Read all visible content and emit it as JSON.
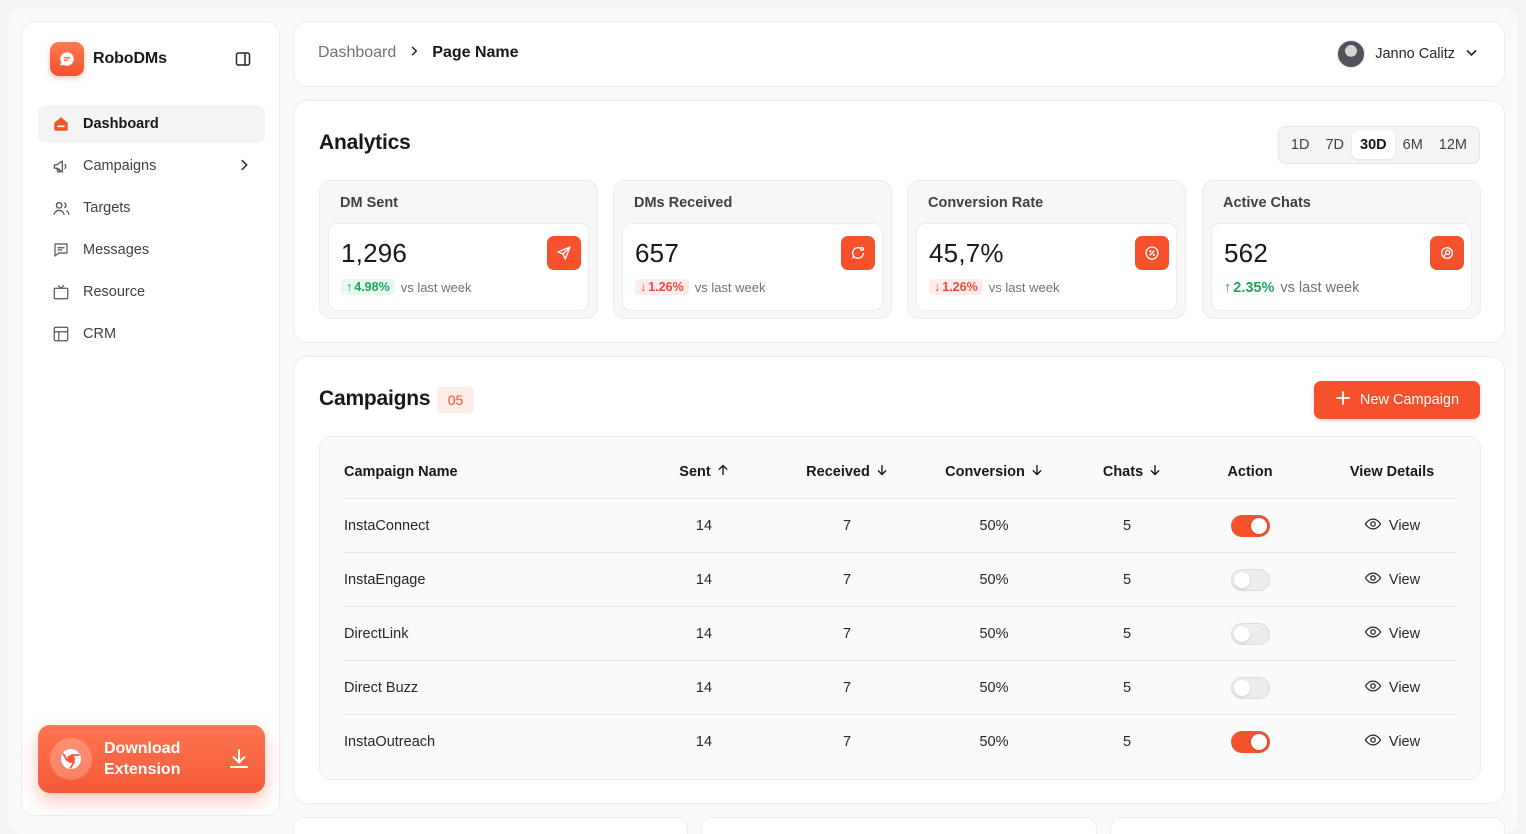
{
  "brand": {
    "name": "RoboDMs"
  },
  "sidebar": {
    "items": [
      {
        "label": "Dashboard",
        "icon": "home-icon",
        "active": true
      },
      {
        "label": "Campaigns",
        "icon": "megaphone-icon",
        "has_children": true
      },
      {
        "label": "Targets",
        "icon": "users-icon"
      },
      {
        "label": "Messages",
        "icon": "message-icon"
      },
      {
        "label": "Resource",
        "icon": "tv-icon"
      },
      {
        "label": "CRM",
        "icon": "layout-icon"
      }
    ],
    "download": {
      "label": "Download Extension"
    }
  },
  "topbar": {
    "breadcrumb": [
      "Dashboard",
      "Page Name"
    ],
    "user_name": "Janno Calitz"
  },
  "analytics": {
    "title": "Analytics",
    "ranges": [
      "1D",
      "7D",
      "30D",
      "6M",
      "12M"
    ],
    "selected_range": "30D",
    "stats": [
      {
        "label": "DM Sent",
        "value": "1,296",
        "change": "4.98%",
        "direction": "up",
        "suffix": "vs last week",
        "icon": "send-icon"
      },
      {
        "label": "DMs Received",
        "value": "657",
        "change": "1.26%",
        "direction": "down",
        "suffix": "vs last week",
        "icon": "message-check-icon"
      },
      {
        "label": "Conversion Rate",
        "value": "45,7%",
        "change": "1.26%",
        "direction": "down",
        "suffix": "vs last week",
        "icon": "percent-icon"
      },
      {
        "label": "Active Chats",
        "value": "562",
        "change": "2.35%",
        "direction": "up",
        "suffix": "vs last week",
        "icon": "chat-search-icon"
      }
    ]
  },
  "campaigns": {
    "title": "Campaigns",
    "count": "05",
    "new_button": "New Campaign",
    "columns": [
      "Campaign Name",
      "Sent",
      "Received",
      "Conversion",
      "Chats",
      "Action",
      "View Details"
    ],
    "rows": [
      {
        "name": "InstaConnect",
        "sent": "14",
        "received": "7",
        "conversion": "50%",
        "chats": "5",
        "active": true,
        "view": "View"
      },
      {
        "name": "InstaEngage",
        "sent": "14",
        "received": "7",
        "conversion": "50%",
        "chats": "5",
        "active": false,
        "view": "View"
      },
      {
        "name": "DirectLink",
        "sent": "14",
        "received": "7",
        "conversion": "50%",
        "chats": "5",
        "active": false,
        "view": "View"
      },
      {
        "name": "Direct Buzz",
        "sent": "14",
        "received": "7",
        "conversion": "50%",
        "chats": "5",
        "active": false,
        "view": "View"
      },
      {
        "name": "InstaOutreach",
        "sent": "14",
        "received": "7",
        "conversion": "50%",
        "chats": "5",
        "active": true,
        "view": "View"
      }
    ]
  },
  "colors": {
    "accent": "#f4512c",
    "positive": "#22a55a",
    "negative": "#ef4b3a"
  }
}
